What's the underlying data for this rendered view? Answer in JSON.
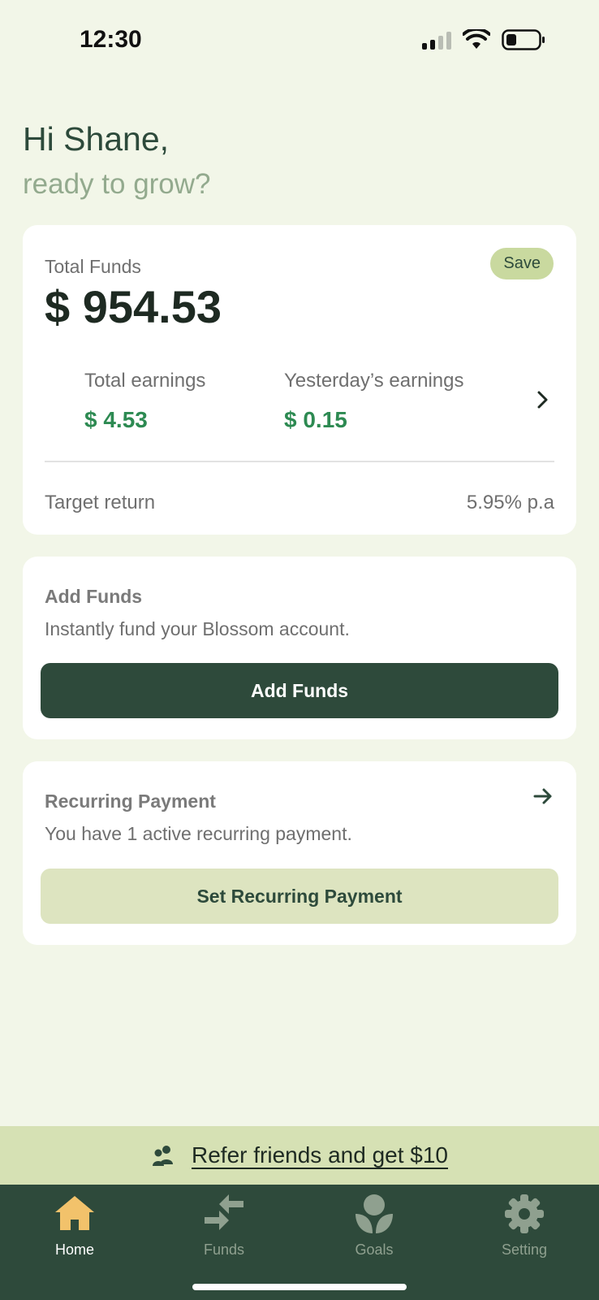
{
  "status_bar": {
    "time": "12:30"
  },
  "greeting": {
    "title": "Hi Shane,",
    "subtitle": "ready to grow?"
  },
  "funds_card": {
    "total_label": "Total Funds",
    "total_amount": "$ 954.53",
    "badge": "Save",
    "total_earnings_label": "Total earnings",
    "total_earnings_value": "$ 4.53",
    "yesterday_label": "Yesterday’s earnings",
    "yesterday_value": "$ 0.15",
    "target_label": "Target return",
    "target_value": "5.95% p.a"
  },
  "add_funds_card": {
    "title": "Add Funds",
    "description": "Instantly fund your Blossom account.",
    "button": "Add Funds"
  },
  "recurring_card": {
    "title": "Recurring Payment",
    "description": "You have 1 active recurring payment.",
    "button": "Set Recurring Payment"
  },
  "referral": {
    "text": "Refer friends and get $10"
  },
  "nav": {
    "items": [
      {
        "label": "Home",
        "icon": "home-icon",
        "active": true
      },
      {
        "label": "Funds",
        "icon": "transfer-icon",
        "active": false
      },
      {
        "label": "Goals",
        "icon": "plant-icon",
        "active": false
      },
      {
        "label": "Setting",
        "icon": "gear-icon",
        "active": false
      }
    ]
  },
  "colors": {
    "background": "#f2f6e8",
    "primary_dark": "#2e4a3b",
    "accent_green": "#2d8a52",
    "badge_bg": "#c9d99f",
    "light_button": "#dde4c0",
    "referral_bg": "#d6e1b4",
    "home_active": "#f2c26b"
  }
}
